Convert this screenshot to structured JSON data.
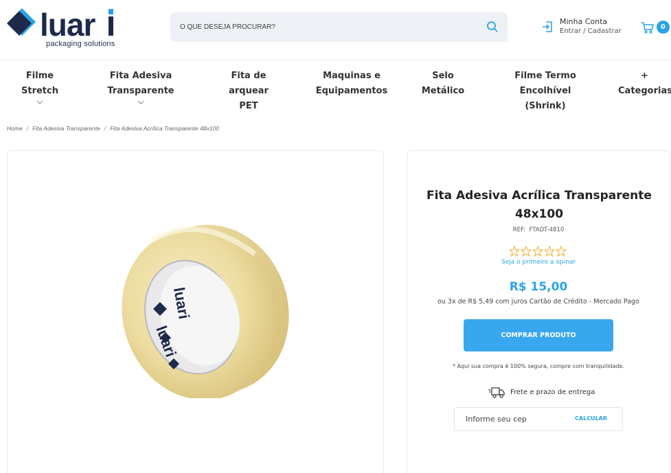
{
  "brand": {
    "name": "luari",
    "tagline": "packaging solutions",
    "colors": {
      "navy": "#1d2a4a",
      "accent": "#2aa3e8"
    }
  },
  "search": {
    "placeholder": "O QUE DESEJA PROCURAR?",
    "icon": "search-icon"
  },
  "account": {
    "title": "Minha Conta",
    "subtitle": "Entrar / Cadastrar",
    "icon": "login-icon"
  },
  "cart": {
    "count": "0",
    "icon": "cart-icon"
  },
  "nav": {
    "items": [
      {
        "label": "Filme Stretch",
        "has_dropdown": true
      },
      {
        "label": "Fita Adesiva Transparente",
        "has_dropdown": true
      },
      {
        "label": "Fita de arquear\nPET",
        "has_dropdown": false
      },
      {
        "label": "Maquinas e\nEquipamentos",
        "has_dropdown": false
      },
      {
        "label": "Selo\nMetálico",
        "has_dropdown": false
      },
      {
        "label": "Filme Termo Encolhível\n(Shrink)",
        "has_dropdown": false
      },
      {
        "label": "+\nCategorias",
        "has_dropdown": false
      }
    ]
  },
  "breadcrumb": {
    "items": [
      "Home",
      "Fita Adesiva Transparente",
      "Fita Adesiva Acrílica Transparente 48x100"
    ],
    "separator": "/"
  },
  "product": {
    "title": "Fita Adesiva Acrílica Transparente 48x100",
    "ref_label": "REF:",
    "ref": "FTADT-4810",
    "rating": {
      "stars": 0,
      "max": 5,
      "link_text": "Seja o primeiro a opinar"
    },
    "price": "R$ 15,00",
    "installments": "ou 3x de R$ 5,49 com juros Cartão de Crédito - Mercado Pago",
    "buy_label": "COMPRAR PRODUTO",
    "secure_text": "* Aqui sua compra é 100% segura, compre com tranquilidade.",
    "shipping_label": "Frete e prazo de entrega",
    "cep_placeholder": "Informe seu cep",
    "cep_button": "CALCULAR",
    "image_core_print": "luari"
  }
}
